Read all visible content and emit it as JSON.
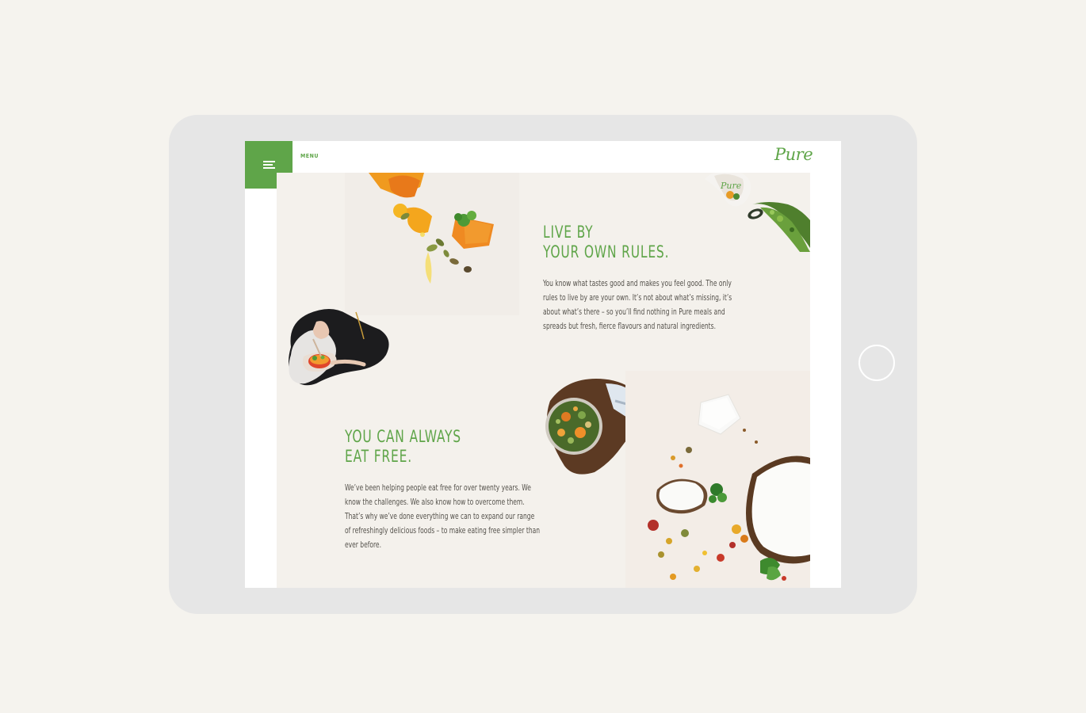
{
  "nav": {
    "menu_label": "MENU",
    "logo_text": "Pure"
  },
  "section1": {
    "heading_line1": "LIVE BY",
    "heading_line2": "YOUR OWN RULES.",
    "body": "You know what tastes good and makes you feel good. The only rules to live by are your own. It’s not about what’s missing, it’s about what’s there – so you’ll find nothing in Pure meals and spreads but fresh, fierce flavours and natural ingredients."
  },
  "section2": {
    "heading_line1": "YOU CAN ALWAYS",
    "heading_line2": "EAT FREE.",
    "body": "We’ve been helping people eat free for over twenty years. We know the challenges. We also know how to overcome them. That’s why we’ve done everything we can to expand our range of refreshingly delicious foods – to make eating free simpler than ever before."
  },
  "colors": {
    "brand_green": "#5fa549",
    "page_bg": "#f5f3ee",
    "tablet_frame": "#e6e6e6",
    "content_bg": "#f4f1ec"
  }
}
